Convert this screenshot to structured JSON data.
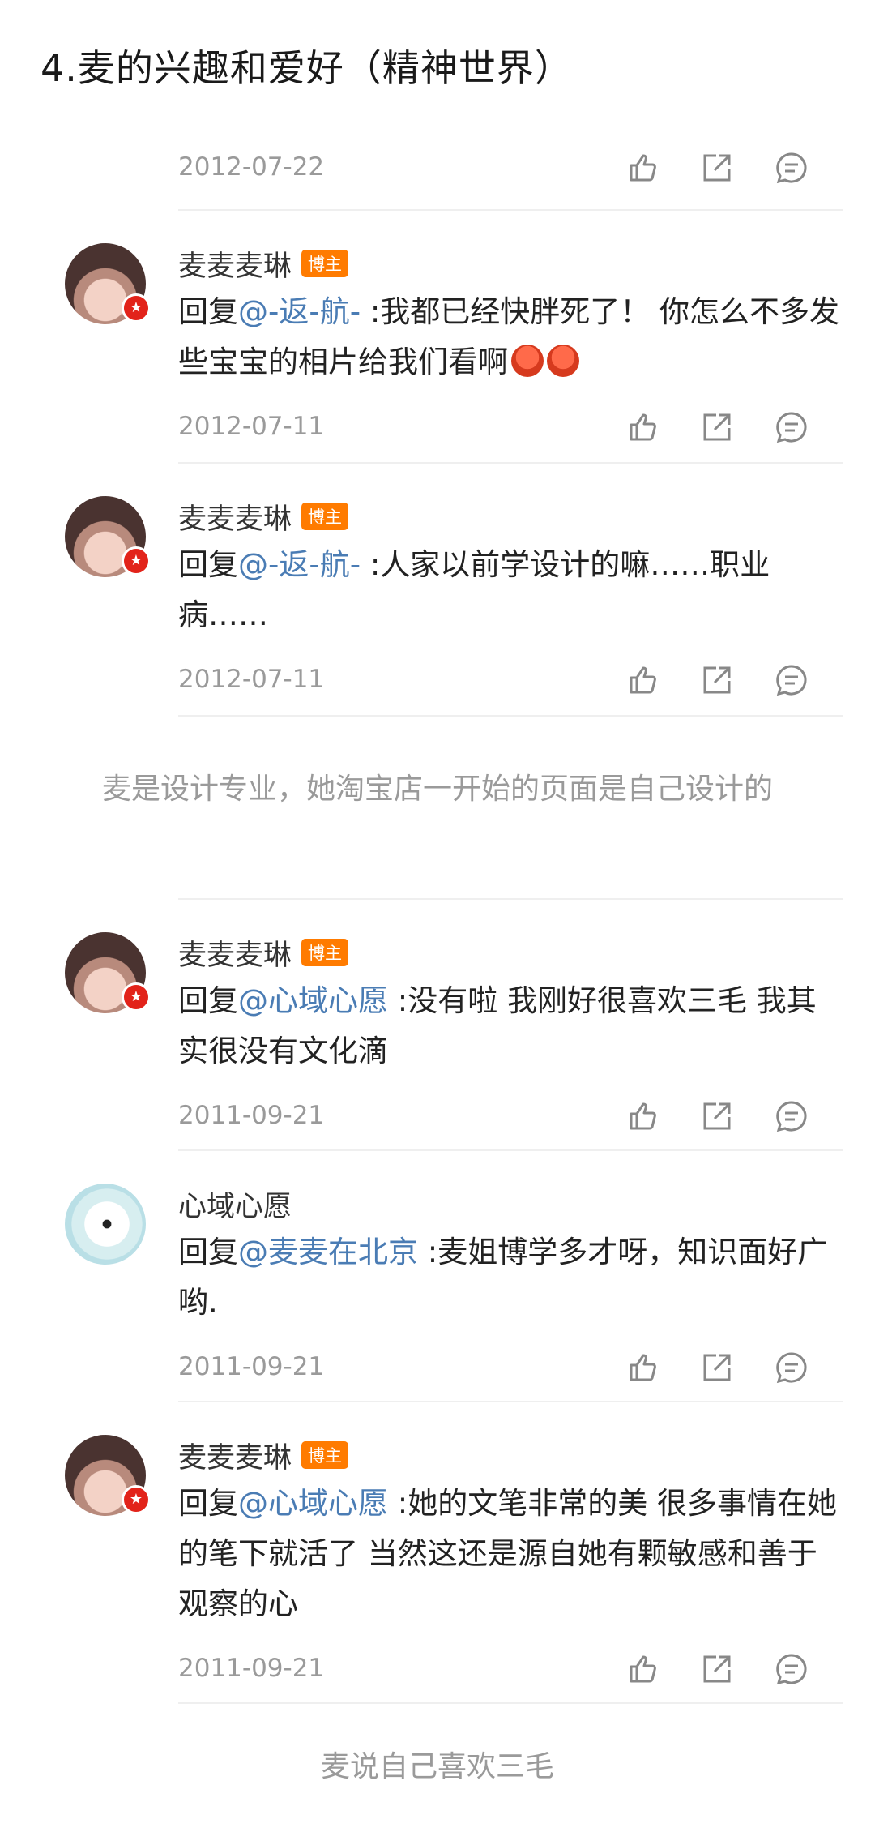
{
  "page": {
    "title": "4.麦的兴趣和爱好（精神世界）"
  },
  "partial_top": {
    "date": "2012-07-22"
  },
  "section1": {
    "comments": [
      {
        "name": "麦麦麦琳",
        "tag": "博主",
        "reply_prefix": "回复",
        "mention": "@-返-航-",
        "text": " :我都已经快胖死了！ 你怎么不多发些宝宝的相片给我们看啊",
        "emoji_icon": "angry-face-emoji",
        "date": "2012-07-11"
      },
      {
        "name": "麦麦麦琳",
        "tag": "博主",
        "reply_prefix": "回复",
        "mention": "@-返-航-",
        "text": " :人家以前学设计的嘛……职业病……",
        "date": "2012-07-11"
      }
    ],
    "caption": "麦是设计专业，她淘宝店一开始的页面是自己设计的"
  },
  "section2": {
    "comments": [
      {
        "name": "麦麦麦琳",
        "tag": "博主",
        "reply_prefix": "回复",
        "mention": "@心域心愿",
        "text": " :没有啦 我刚好很喜欢三毛 我其实很没有文化滴",
        "date": "2011-09-21"
      },
      {
        "name": "心域心愿",
        "reply_prefix": "回复",
        "mention": "@麦麦在北京",
        "text": " :麦姐博学多才呀，知识面好广哟.",
        "date": "2011-09-21"
      },
      {
        "name": "麦麦麦琳",
        "tag": "博主",
        "reply_prefix": "回复",
        "mention": "@心域心愿",
        "text": " :她的文笔非常的美 很多事情在她的笔下就活了 当然这还是源自她有颗敏感和善于观察的心",
        "date": "2011-09-21"
      }
    ],
    "caption": "麦说自己喜欢三毛"
  },
  "icons": {
    "like": "thumbs-up-icon",
    "share": "share-icon",
    "comment": "comment-icon",
    "verified": "verified-badge-icon"
  },
  "colors": {
    "mention": "#4a7cb4",
    "tag": "#ff7b00",
    "badge": "#e2231a",
    "muted": "#9a9a9a"
  }
}
